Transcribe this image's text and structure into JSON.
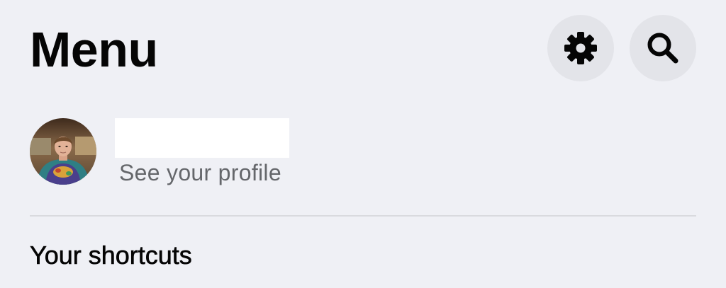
{
  "header": {
    "title": "Menu",
    "actions": [
      {
        "name": "settings",
        "icon": "gear-icon"
      },
      {
        "name": "search",
        "icon": "search-icon"
      }
    ]
  },
  "profile": {
    "name": "",
    "subtitle": "See your profile",
    "avatar_icon": "avatar"
  },
  "sections": {
    "shortcuts_heading": "Your shortcuts"
  },
  "colors": {
    "background": "#eff0f5",
    "button_background": "#e3e4e9",
    "secondary_text": "#65676b",
    "primary_text": "#050505"
  }
}
